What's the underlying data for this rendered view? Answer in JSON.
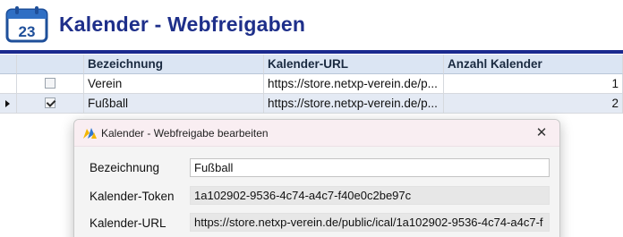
{
  "header": {
    "icon_day": "23",
    "title": "Kalender - Webfreigaben"
  },
  "grid": {
    "columns": [
      "",
      "Bezeichnung",
      "Kalender-URL",
      "Anzahl Kalender"
    ],
    "rows": [
      {
        "checked": false,
        "name": "Verein",
        "url": "https://store.netxp-verein.de/p...",
        "count": "1",
        "current": false
      },
      {
        "checked": true,
        "name": "Fußball",
        "url": "https://store.netxp-verein.de/p...",
        "count": "2",
        "current": true
      }
    ]
  },
  "dialog": {
    "title": "Kalender - Webfreigabe bearbeiten",
    "close_glyph": "✕",
    "fields": [
      {
        "label": "Bezeichnung",
        "value": "Fußball"
      },
      {
        "label": "Kalender-Token",
        "value": "1a102902-9536-4c74-a4c7-f40e0c2be97c"
      },
      {
        "label": "Kalender-URL",
        "value": "https://store.netxp-verein.de/public/ical/1a102902-9536-4c74-a4c7-f"
      }
    ]
  },
  "colors": {
    "title_blue": "#1e2f8a",
    "rule_blue": "#1b2a8f",
    "header_bg": "#dbe5f3",
    "selected_row_bg": "#e4eaf4",
    "dialog_titlebar": "#f9eef2"
  },
  "icons": {
    "header": "calendar-icon",
    "dialog": "app-logo-icon",
    "row_indicator": "row-pointer-icon"
  }
}
